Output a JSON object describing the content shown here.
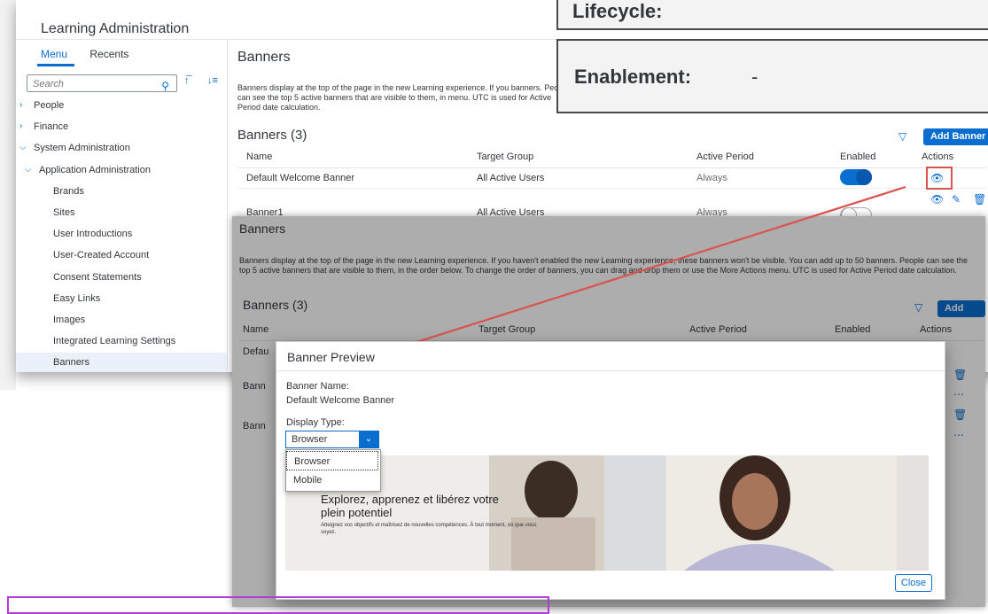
{
  "app_title": "Learning Administration",
  "menu_tabs": [
    "Menu",
    "Recents"
  ],
  "search_placeholder": "Search",
  "menu": [
    {
      "label": "People",
      "indent": 0,
      "chev": ">"
    },
    {
      "label": "Finance",
      "indent": 0,
      "chev": ">"
    },
    {
      "label": "System Administration",
      "indent": 0,
      "chev": "v"
    },
    {
      "label": "Application Administration",
      "indent": 1,
      "chev": "v"
    },
    {
      "label": "Brands",
      "indent": 2,
      "chev": ""
    },
    {
      "label": "Sites",
      "indent": 2,
      "chev": ""
    },
    {
      "label": "User Introductions",
      "indent": 2,
      "chev": ""
    },
    {
      "label": "User-Created Account",
      "indent": 2,
      "chev": ""
    },
    {
      "label": "Consent Statements",
      "indent": 2,
      "chev": ""
    },
    {
      "label": "Easy Links",
      "indent": 2,
      "chev": ""
    },
    {
      "label": "Images",
      "indent": 2,
      "chev": ""
    },
    {
      "label": "Integrated Learning Settings",
      "indent": 2,
      "chev": ""
    },
    {
      "label": "Banners",
      "indent": 2,
      "chev": "",
      "selected": true
    }
  ],
  "page": {
    "title": "Banners",
    "description_short": "Banners display at the top of the page in the new Learning experience. If you banners. People can see the top 5 active banners that are visible to them, in menu. UTC is used for Active Period date calculation.",
    "description_full": "Banners display at the top of the page in the new Learning experience. If you haven't enabled the new Learning experience, these banners won't be visible. You can add up to 50 banners. People can see the top 5 active banners that are visible to them, in the order below. To change the order of banners, you can drag and drop them or use the More Actions menu. UTC is used for Active Period date calculation.",
    "table_title": "Banners (3)",
    "add_button": "Add Banner",
    "columns": [
      "Name",
      "Target Group",
      "Active Period",
      "Enabled",
      "Actions"
    ],
    "rows": [
      {
        "name": "Default Welcome Banner",
        "group": "All Active Users",
        "period": "Always",
        "enabled": true
      },
      {
        "name": "Banner1",
        "group": "All Active Users",
        "period": "Always",
        "enabled": false
      }
    ],
    "dim_row_prefixes": [
      "Defau",
      "Bann",
      "Bann"
    ]
  },
  "callouts": {
    "top": "Lifecycle:",
    "enablement_label": "Enablement:",
    "enablement_value": "-"
  },
  "dialog": {
    "title": "Banner Preview",
    "name_label": "Banner Name:",
    "name_value": "Default Welcome Banner",
    "display_label": "Display Type:",
    "selected": "Browser",
    "options": [
      "Browser",
      "Mobile"
    ],
    "banner_heading": "Explorez, apprenez et libérez votre plein potentiel",
    "banner_sub": "Atteignez vos objectifs et maîtrisez de nouvelles compétences. À tout moment, où que vous soyez.",
    "close": "Close"
  }
}
